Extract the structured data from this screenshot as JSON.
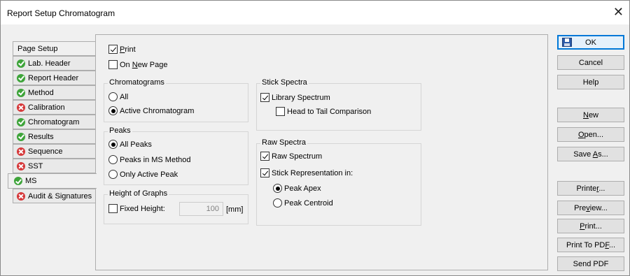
{
  "window": {
    "title": "Report Setup Chromatogram",
    "close_glyph": "✕"
  },
  "tabs": [
    {
      "label": "Page Setup",
      "status": "none"
    },
    {
      "label": "Lab. Header",
      "status": "ok"
    },
    {
      "label": "Report Header",
      "status": "ok"
    },
    {
      "label": "Method",
      "status": "ok"
    },
    {
      "label": "Calibration",
      "status": "error"
    },
    {
      "label": "Chromatogram",
      "status": "ok"
    },
    {
      "label": "Results",
      "status": "ok"
    },
    {
      "label": "Sequence",
      "status": "error"
    },
    {
      "label": "SST",
      "status": "error"
    },
    {
      "label": "MS",
      "status": "ok",
      "active": true
    },
    {
      "label": "Audit & Signatures",
      "status": "error"
    }
  ],
  "print_options": {
    "print": {
      "label_mnemonic": "P",
      "label_rest": "rint",
      "checked": true
    },
    "on_new_page": {
      "label_pre": "On ",
      "label_mnemonic": "N",
      "label_rest": "ew Page",
      "checked": false
    }
  },
  "chromatograms": {
    "title": "Chromatograms",
    "options": [
      {
        "label": "All",
        "checked": false
      },
      {
        "label": "Active Chromatogram",
        "checked": true
      }
    ]
  },
  "peaks": {
    "title": "Peaks",
    "options": [
      {
        "label": "All Peaks",
        "checked": true
      },
      {
        "label": "Peaks in MS Method",
        "checked": false
      },
      {
        "label": "Only Active Peak",
        "checked": false
      }
    ]
  },
  "height_of_graphs": {
    "title": "Height of Graphs",
    "fixed_height_label": "Fixed Height:",
    "fixed_height_checked": false,
    "value": "100",
    "unit": "[mm]"
  },
  "stick_spectra": {
    "title": "Stick Spectra",
    "library_spectrum": {
      "label": "Library Spectrum",
      "checked": true
    },
    "head_to_tail": {
      "label": "Head to Tail Comparison",
      "checked": false
    }
  },
  "raw_spectra": {
    "title": "Raw Spectra",
    "raw_spectrum": {
      "label": "Raw Spectrum",
      "checked": true
    },
    "stick_representation": {
      "label": "Stick Representation in:",
      "checked": true
    },
    "options": [
      {
        "label": "Peak Apex",
        "checked": true
      },
      {
        "label": "Peak Centroid",
        "checked": false
      }
    ]
  },
  "buttons": {
    "ok": "OK",
    "cancel": "Cancel",
    "help": "Help",
    "new": {
      "pre": "",
      "mn": "N",
      "post": "ew"
    },
    "open": {
      "pre": "",
      "mn": "O",
      "post": "pen..."
    },
    "save_as": {
      "pre": "Save ",
      "mn": "A",
      "post": "s..."
    },
    "printer": {
      "pre": "Printe",
      "mn": "r",
      "post": "..."
    },
    "preview": {
      "pre": "Pre",
      "mn": "v",
      "post": "iew..."
    },
    "print": {
      "pre": "",
      "mn": "P",
      "post": "rint..."
    },
    "print_to_pdf": {
      "pre": "Print To PD",
      "mn": "F",
      "post": "..."
    },
    "send_pdf": "Send PDF"
  },
  "colors": {
    "ok_status": "#3ea43a",
    "error_status": "#d6383a",
    "focus_border": "#0078d7"
  }
}
